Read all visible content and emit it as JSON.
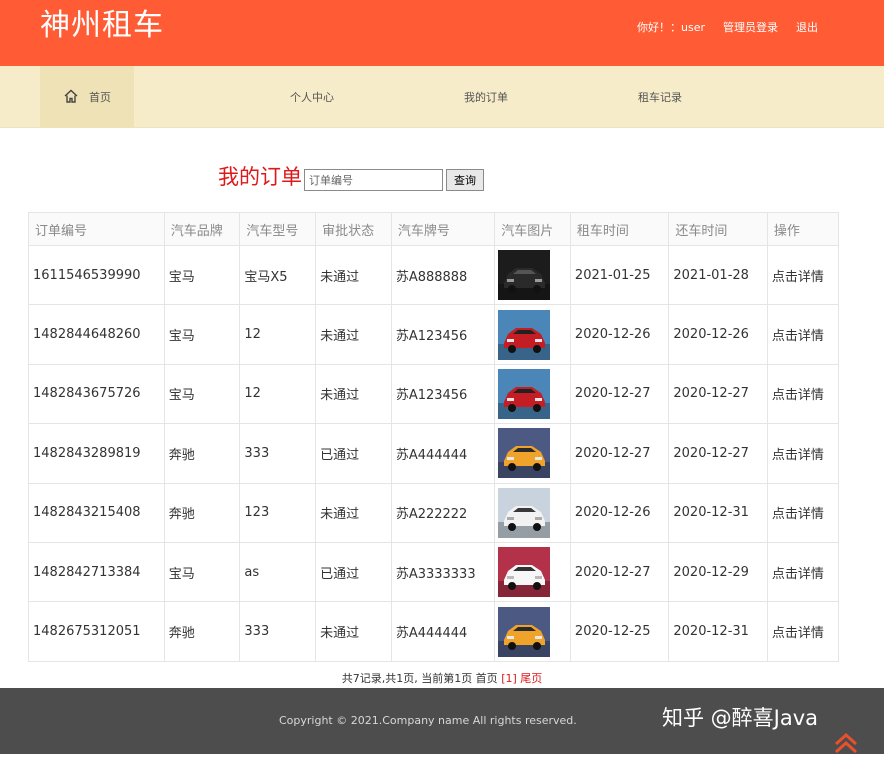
{
  "header": {
    "logo": "神州租车",
    "greeting": "你好！：user",
    "admin_login": "管理员登录",
    "logout": "退出"
  },
  "nav": {
    "home": "首页",
    "personal_center": "个人中心",
    "my_orders": "我的订单",
    "rental_records": "租车记录"
  },
  "search": {
    "title": "我的订单",
    "placeholder": "订单编号",
    "button": "查询"
  },
  "table": {
    "headers": [
      "订单编号",
      "汽车品牌",
      "汽车型号",
      "审批状态",
      "汽车牌号",
      "汽车图片",
      "租车时间",
      "还车时间",
      "操作"
    ],
    "rows": [
      {
        "order_no": "1611546539990",
        "brand": "宝马",
        "model": "宝马X5",
        "status": "未通过",
        "plate": "苏A888888",
        "image": "black-car",
        "rent_date": "2021-01-25",
        "return_date": "2021-01-28",
        "action": "点击详情"
      },
      {
        "order_no": "1482844648260",
        "brand": "宝马",
        "model": "12",
        "status": "未通过",
        "plate": "苏A123456",
        "image": "red-car",
        "rent_date": "2020-12-26",
        "return_date": "2020-12-26",
        "action": "点击详情"
      },
      {
        "order_no": "1482843675726",
        "brand": "宝马",
        "model": "12",
        "status": "未通过",
        "plate": "苏A123456",
        "image": "red-car",
        "rent_date": "2020-12-27",
        "return_date": "2020-12-27",
        "action": "点击详情"
      },
      {
        "order_no": "1482843289819",
        "brand": "奔驰",
        "model": "333",
        "status": "已通过",
        "plate": "苏A444444",
        "image": "yellow-car",
        "rent_date": "2020-12-27",
        "return_date": "2020-12-27",
        "action": "点击详情"
      },
      {
        "order_no": "1482843215408",
        "brand": "奔驰",
        "model": "123",
        "status": "未通过",
        "plate": "苏A222222",
        "image": "white-car",
        "rent_date": "2020-12-26",
        "return_date": "2020-12-31",
        "action": "点击详情"
      },
      {
        "order_no": "1482842713384",
        "brand": "宝马",
        "model": "as",
        "status": "已通过",
        "plate": "苏A3333333",
        "image": "white-suv",
        "rent_date": "2020-12-27",
        "return_date": "2020-12-29",
        "action": "点击详情"
      },
      {
        "order_no": "1482675312051",
        "brand": "奔驰",
        "model": "333",
        "status": "未通过",
        "plate": "苏A444444",
        "image": "yellow-car",
        "rent_date": "2020-12-25",
        "return_date": "2020-12-31",
        "action": "点击详情"
      }
    ]
  },
  "pager": {
    "summary": "共7记录,共1页, 当前第1页 首页 ",
    "current": "[1]",
    "last": "尾页"
  },
  "footer": {
    "copyright": "Copyright © 2021.Company name All rights reserved.",
    "watermark": "知乎 @醉喜Java"
  },
  "colors": {
    "header_bg": "#ff5c35",
    "nav_bg": "#f6ecca",
    "title_red": "#dd1a1a",
    "footer_bg": "#4d4d4d"
  },
  "icons": {
    "home": "home-icon",
    "back_to_top": "chevron-up-icon"
  }
}
